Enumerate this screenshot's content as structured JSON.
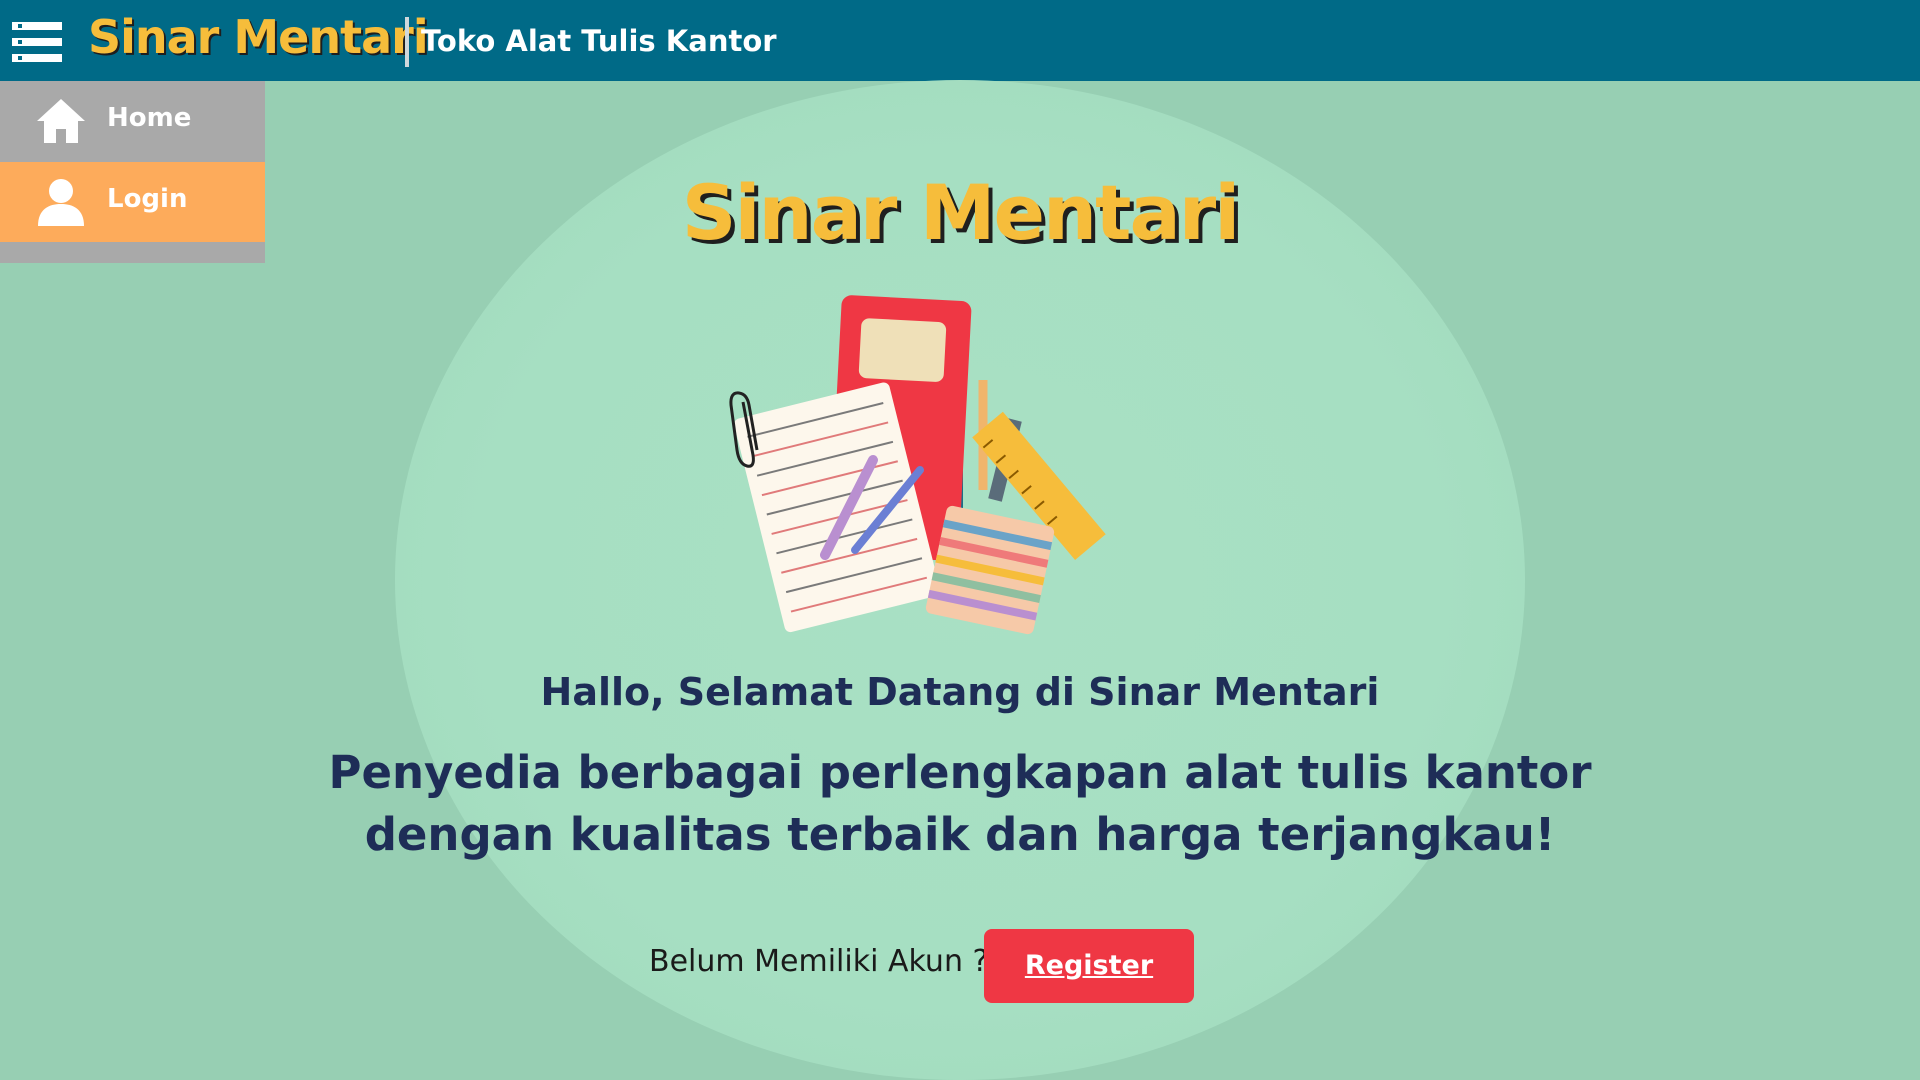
{
  "header": {
    "brand": "Sinar Mentari",
    "tagline": "Toko Alat Tulis Kantor",
    "menu_icon": "hamburger-menu-icon"
  },
  "sidebar": {
    "items": [
      {
        "label": "Home",
        "icon": "home-icon"
      },
      {
        "label": "Login",
        "icon": "user-icon"
      }
    ]
  },
  "hero": {
    "title": "Sinar Mentari",
    "welcome": "Hallo, Selamat Datang di Sinar Mentari",
    "headline_line1": "Penyedia berbagai perlengkapan alat tulis kantor",
    "headline_line2": "dengan kualitas terbaik dan harga terjangkau!"
  },
  "register": {
    "prompt": "Belum Memiliki Akun ?",
    "button_label": "Register"
  },
  "colors": {
    "background": "#97cfb3",
    "header": "#006a87",
    "brand_yellow": "#f6bd3b",
    "sidebar_gray": "#a9a9a9",
    "login_orange": "#fdab5b",
    "register_red": "#ef3744",
    "text_navy": "#1e2d57"
  }
}
